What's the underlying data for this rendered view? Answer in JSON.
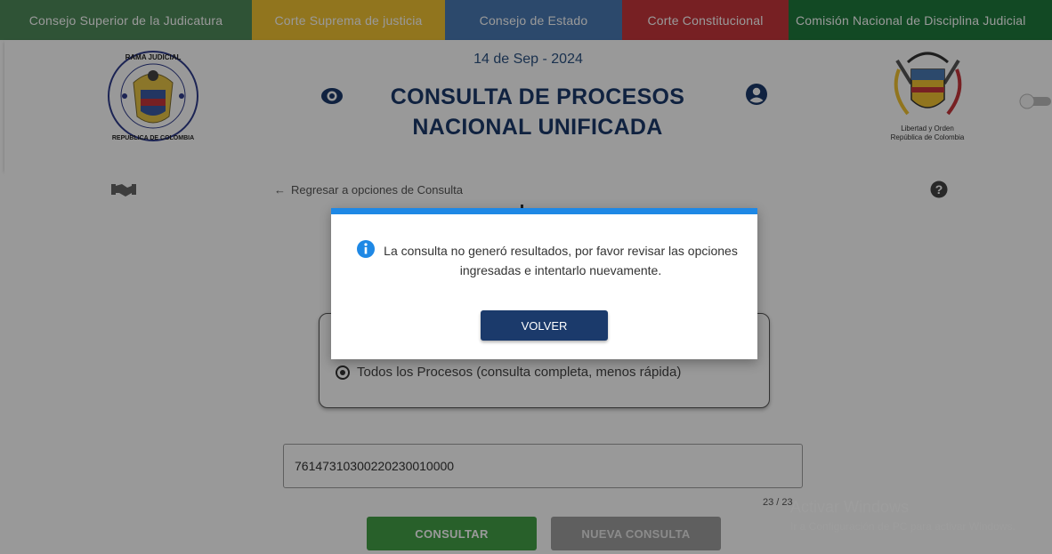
{
  "topnav": {
    "items": [
      {
        "label": "Consejo Superior de la Judicatura",
        "color": "#4f8a5b"
      },
      {
        "label": "Corte Suprema de justicia",
        "color": "#f2c432"
      },
      {
        "label": "Consejo de Estado",
        "color": "#4a7ab5"
      },
      {
        "label": "Corte Constitucional",
        "color": "#c7363b"
      },
      {
        "label": "Comisión Nacional de Disciplina Judicial",
        "color": "#1e7a3c"
      }
    ]
  },
  "header": {
    "date": "14 de Sep - 2024",
    "title_line1": "CONSULTA DE PROCESOS",
    "title_line2": "NACIONAL UNIFICADA",
    "seal_left_text": "RAMA JUDICIAL · REPUBLICA DE COLOMBIA",
    "shield_caption_line1": "Libertad y Orden",
    "shield_caption_line2": "República de Colombia"
  },
  "content": {
    "back_link": "Regresar a opciones de Consulta",
    "option_label": "Todos los Procesos (consulta completa, menos rápida)",
    "option_selected": true,
    "search_value": "76147310300220230010000",
    "counter": "23 / 23",
    "consultar_label": "CONSULTAR",
    "nueva_label": "NUEVA CONSULTA"
  },
  "modal": {
    "message": "La consulta no generó resultados, por favor revisar las opciones ingresadas e intentarlo nuevamente.",
    "button_label": "VOLVER",
    "accent_color": "#1e88e5"
  },
  "watermark": {
    "line1": "Activar Windows",
    "line2": "Ir a Configuración de PC para activar Windows."
  },
  "icons": [
    "eye-icon",
    "user-icon",
    "handshake-icon",
    "arrow-left-icon",
    "help-icon",
    "info-icon",
    "toggle-icon"
  ]
}
